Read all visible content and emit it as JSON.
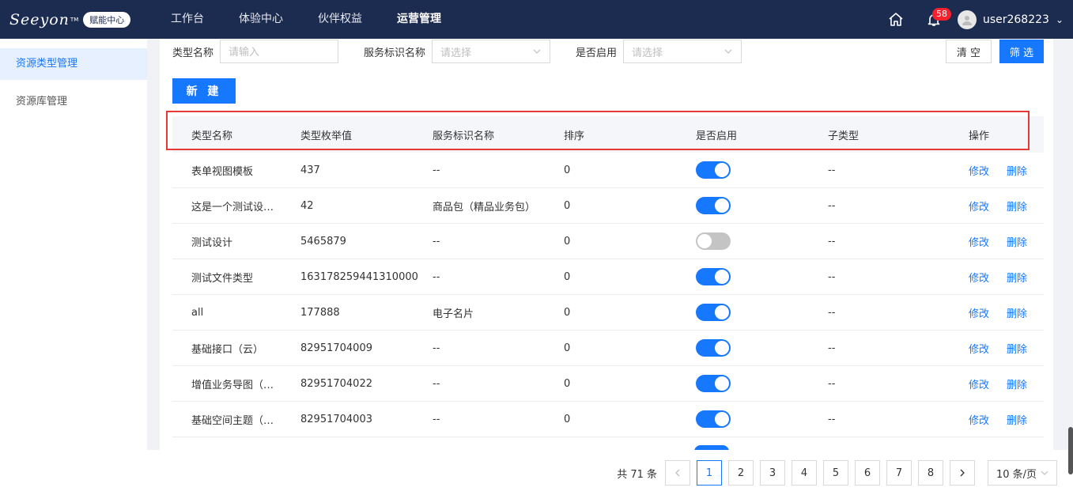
{
  "header": {
    "logo_text": "Seeyon",
    "logo_tm": "TM",
    "logo_badge": "赋能中心",
    "nav": [
      "工作台",
      "体验中心",
      "伙伴权益",
      "运营管理"
    ],
    "active_nav": 3,
    "notification_count": "58",
    "username": "user268223",
    "icons": [
      "home-icon",
      "bell-icon",
      "user-icon",
      "chevron-down-icon"
    ]
  },
  "sidebar": {
    "items": [
      "资源类型管理",
      "资源库管理"
    ],
    "active": 0
  },
  "filters": {
    "type_name_label": "类型名称",
    "type_name_placeholder": "请输入",
    "service_label": "服务标识名称",
    "service_placeholder": "请选择",
    "enabled_label": "是否启用",
    "enabled_placeholder": "请选择",
    "clear_label": "清 空",
    "filter_label": "筛 选"
  },
  "new_button": "新 建",
  "table": {
    "columns": [
      "类型名称",
      "类型枚举值",
      "服务标识名称",
      "排序",
      "是否启用",
      "子类型",
      "操作"
    ],
    "rows": [
      {
        "name": "表单视图模板",
        "value": "437",
        "service": "--",
        "sort": "0",
        "enabled": true,
        "sub": "--"
      },
      {
        "name": "这是一个测试设…",
        "value": "42",
        "service": "商品包（精品业务包）",
        "sort": "0",
        "enabled": true,
        "sub": "--"
      },
      {
        "name": "测试设计",
        "value": "5465879",
        "service": "--",
        "sort": "0",
        "enabled": false,
        "sub": "--"
      },
      {
        "name": "测试文件类型",
        "value": "163178259441310000",
        "service": "--",
        "sort": "0",
        "enabled": true,
        "sub": "--"
      },
      {
        "name": "all",
        "value": "177888",
        "service": "电子名片",
        "sort": "0",
        "enabled": true,
        "sub": "--"
      },
      {
        "name": "基础接口（云）",
        "value": "82951704009",
        "service": "--",
        "sort": "0",
        "enabled": true,
        "sub": "--"
      },
      {
        "name": "增值业务导图（…",
        "value": "82951704022",
        "service": "--",
        "sort": "0",
        "enabled": true,
        "sub": "--"
      },
      {
        "name": "基础空间主题（…",
        "value": "82951704003",
        "service": "--",
        "sort": "0",
        "enabled": true,
        "sub": "--"
      }
    ],
    "edit_label": "修改",
    "delete_label": "删除"
  },
  "pagination": {
    "total": "共 71 条",
    "pages": [
      "1",
      "2",
      "3",
      "4",
      "5",
      "6",
      "7",
      "8"
    ],
    "current": "1",
    "page_size": "10 条/页"
  },
  "colors": {
    "header_bg": "#1c2b50",
    "primary": "#1677ff",
    "highlight": "#e53935"
  }
}
